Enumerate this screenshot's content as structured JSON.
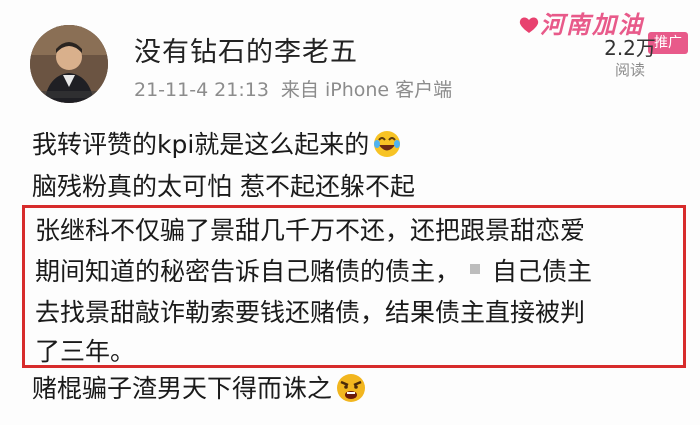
{
  "post": {
    "username": "没有钻石的李老五",
    "date": "21-11-4",
    "time": "21:13",
    "source": "来自 iPhone 客户端",
    "views_count": "2.2万",
    "views_label": "阅读",
    "promo_badge": "推广",
    "watermark": "河南加油",
    "line1": "我转评赞的kpi就是这么起来的",
    "line2": "脑残粉真的太可怕 惹不起还躲不起",
    "highlight": {
      "line1": "张继科不仅骗了景甜几千万不还，还把跟景甜恋爱",
      "line2a": "期间知道的秘密告诉自己赌债的债主，",
      "line2b": "自己债主",
      "line3": "去找景甜敲诈勒索要钱还赌债，结果债主直接被判",
      "line4": "了三年。",
      "border_color": "#d72b2b"
    },
    "line6": "赌棍骗子渣男天下得而诛之",
    "icons": {
      "laugh": "laughing-crying-emoji-icon",
      "angry": "angry-emoji-icon",
      "heart": "heart-icon"
    }
  }
}
